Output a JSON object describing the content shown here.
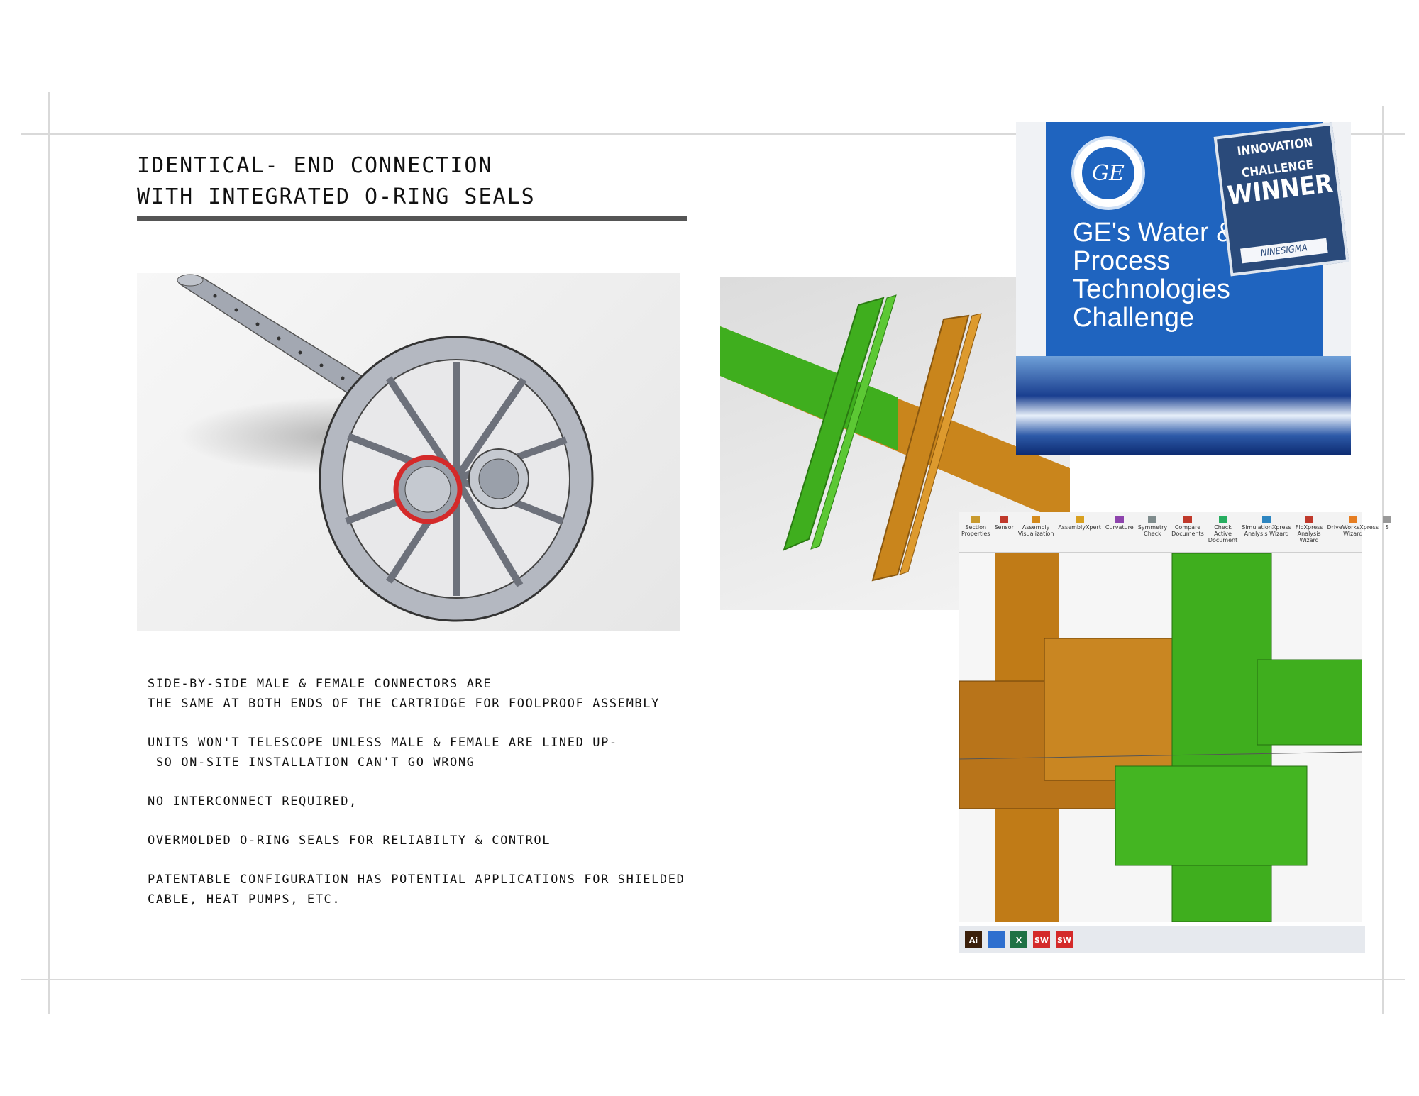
{
  "heading": {
    "line1": "IDENTICAL- END CONNECTION",
    "line2": "WITH INTEGRATED O-RING SEALS"
  },
  "paragraphs": [
    {
      "line1": "SIDE-BY-SIDE MALE & FEMALE CONNECTORS ARE",
      "line2": "THE SAME AT BOTH ENDS OF THE CARTRIDGE FOR FOOLPROOF ASSEMBLY"
    },
    {
      "line1": "UNITS WON'T TELESCOPE UNLESS MALE & FEMALE ARE LINED UP-",
      "line2": " SO ON-SITE INSTALLATION CAN'T GO WRONG"
    },
    {
      "line1": "NO INTERCONNECT REQUIRED,",
      "line2": ""
    },
    {
      "line1": "OVERMOLDED O-RING SEALS FOR RELIABILTY & CONTROL",
      "line2": ""
    },
    {
      "line1": "PATENTABLE CONFIGURATION HAS POTENTIAL APPLICATIONS FOR SHIELDED",
      "line2": "CABLE, HEAT PUMPS, ETC."
    }
  ],
  "ge_panel": {
    "logo_text": "GE",
    "line1": "GE's Water &",
    "line2": "Process",
    "line3": "Technologies",
    "line4": "Challenge",
    "badge_line1": "INNOVATION",
    "badge_line2": "CHALLENGE",
    "badge_line3": "WINNER",
    "badge_sponsor": "NINESIGMA"
  },
  "sw_toolbar": [
    {
      "label": "Section\nProperties",
      "icon": "section-icon",
      "color": "#c99a2e"
    },
    {
      "label": "Sensor",
      "icon": "sensor-icon",
      "color": "#c0392b"
    },
    {
      "label": "Assembly\nVisualization",
      "icon": "assembly-visualization-icon",
      "color": "#d48a1c"
    },
    {
      "label": "AssemblyXpert",
      "icon": "assemblyxpert-icon",
      "color": "#d8a020"
    },
    {
      "label": "Curvature",
      "icon": "curvature-icon",
      "color": "#8e44ad"
    },
    {
      "label": "Symmetry\nCheck",
      "icon": "symmetry-check-icon",
      "color": "#7f8c8d"
    },
    {
      "label": "Compare\nDocuments",
      "icon": "compare-documents-icon",
      "color": "#c0392b"
    },
    {
      "label": "Check\nActive\nDocument",
      "icon": "check-active-document-icon",
      "color": "#27ae60"
    },
    {
      "label": "SimulationXpress\nAnalysis Wizard",
      "icon": "simulationxpress-icon",
      "color": "#2e86c1"
    },
    {
      "label": "FloXpress\nAnalysis\nWizard",
      "icon": "floxpress-icon",
      "color": "#c0392b"
    },
    {
      "label": "DriveWorksXpress\nWizard",
      "icon": "driveworksxpress-icon",
      "color": "#e67e22"
    },
    {
      "label": "S",
      "icon": "more-icon",
      "color": "#999999"
    }
  ],
  "taskbar": [
    {
      "label": "Ai",
      "icon": "illustrator-icon",
      "color": "#3a1f0a"
    },
    {
      "label": "",
      "icon": "clock-icon",
      "color": "#2e6fcf"
    },
    {
      "label": "X",
      "icon": "excel-icon",
      "color": "#1e7145"
    },
    {
      "label": "SW",
      "icon": "solidworks-icon",
      "color": "#d42a2a"
    },
    {
      "label": "SW",
      "icon": "solidworks-icon-2",
      "color": "#d42a2a"
    }
  ],
  "colors": {
    "ge_blue": "#1f64bf",
    "green_part": "#3fae1e",
    "orange_part": "#c9851c",
    "gray_part": "#9ea3ad",
    "oring_red": "#d42a2a"
  }
}
